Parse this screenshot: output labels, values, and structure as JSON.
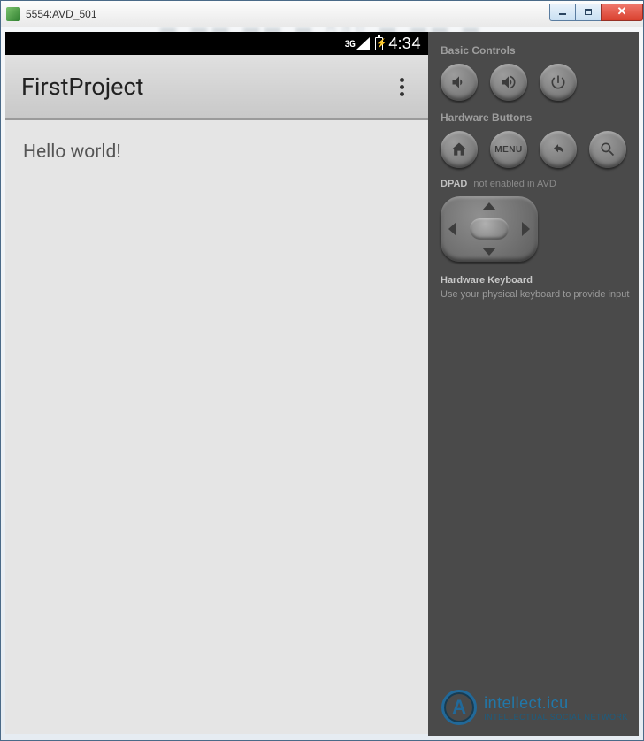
{
  "window": {
    "title": "5554:AVD_501"
  },
  "status_bar": {
    "network_label": "3G",
    "clock": "4:34"
  },
  "app": {
    "title": "FirstProject",
    "body_text": "Hello world!"
  },
  "side_panel": {
    "basic_controls_heading": "Basic Controls",
    "hardware_buttons_heading": "Hardware Buttons",
    "menu_label": "MENU",
    "dpad_label": "DPAD",
    "dpad_status": "not enabled in AVD",
    "keyboard_heading": "Hardware Keyboard",
    "keyboard_hint": "Use your physical keyboard to provide input"
  },
  "watermark": {
    "logo_letter": "A",
    "text": "intellect.icu",
    "subtext": "INTELLECTUAL SOCIAL NETWORK"
  }
}
